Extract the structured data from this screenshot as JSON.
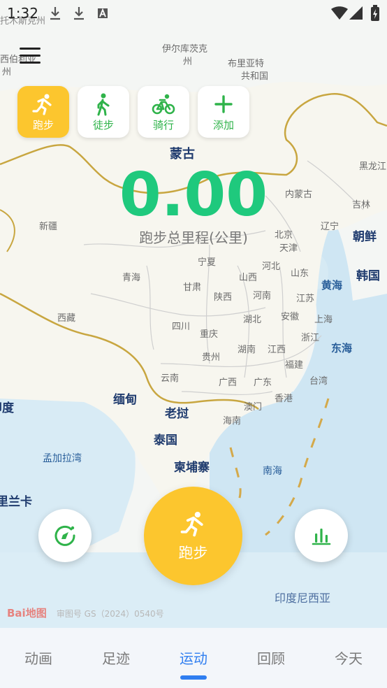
{
  "status_bar": {
    "time": "1:32"
  },
  "modes": [
    {
      "label": "跑步",
      "icon": "running-icon",
      "active": true
    },
    {
      "label": "徒步",
      "icon": "walking-icon",
      "active": false
    },
    {
      "label": "骑行",
      "icon": "bicycle-icon",
      "active": false
    },
    {
      "label": "添加",
      "icon": "plus-icon",
      "active": false
    }
  ],
  "stats": {
    "distance": "0.00",
    "distance_label": "跑步总里程(公里)"
  },
  "start_button": {
    "label": "跑步",
    "icon": "running-icon"
  },
  "left_button": {
    "icon": "compass-icon"
  },
  "right_button": {
    "icon": "bar-chart-icon"
  },
  "map": {
    "labels": {
      "tomsk": "托木斯克州",
      "irkutsk": "伊尔库茨克",
      "irkutsk2": "州",
      "buryatia": "布里亚特",
      "buryatia2": "共和国",
      "siberia_a": "西伯利亚",
      "siberia_b": "州",
      "mongolia": "蒙古",
      "heilongjiang": "黑龙江",
      "jilin": "吉林",
      "neimenggu": "内蒙古",
      "xinjiang": "新疆",
      "liaoning": "辽宁",
      "north_korea": "朝鲜",
      "south_korea": "韩国",
      "beijing": "北京",
      "tianjin": "天津",
      "ningxia": "宁夏",
      "hebei": "河北",
      "shandong": "山东",
      "qinghai": "青海",
      "gansu": "甘肃",
      "shanxi": "山西",
      "shaanxi": "陕西",
      "henan": "河南",
      "jiangsu": "江苏",
      "yellow_sea": "黄海",
      "xizang": "西藏",
      "sichuan": "四川",
      "hubei": "湖北",
      "anhui": "安徽",
      "shanghai": "上海",
      "chongqing": "重庆",
      "zhejiang": "浙江",
      "east_sea": "东海",
      "guizhou": "贵州",
      "hunan": "湖南",
      "jiangxi": "江西",
      "fujian": "福建",
      "yunnan": "云南",
      "guangxi": "广西",
      "guangdong": "广东",
      "taiwan": "台湾",
      "india": "印度",
      "myanmar": "缅甸",
      "laos": "老挝",
      "macau": "澳门",
      "hongkong": "香港",
      "hainan": "海南",
      "thailand": "泰国",
      "bengal": "孟加拉湾",
      "cambodia": "柬埔寨",
      "south_sea": "南海",
      "srilanka": "斯里兰卡",
      "indonesia": "印度尼西亚"
    },
    "watermark": "Bai地图",
    "license": "审图号 GS（2024）0540号"
  },
  "nav": {
    "tabs": [
      "动画",
      "足迹",
      "运动",
      "回顾",
      "今天"
    ],
    "active_index": 2
  },
  "colors": {
    "accent": "#fcc62e",
    "green": "#1fc97d",
    "blue": "#2f7ef0"
  }
}
